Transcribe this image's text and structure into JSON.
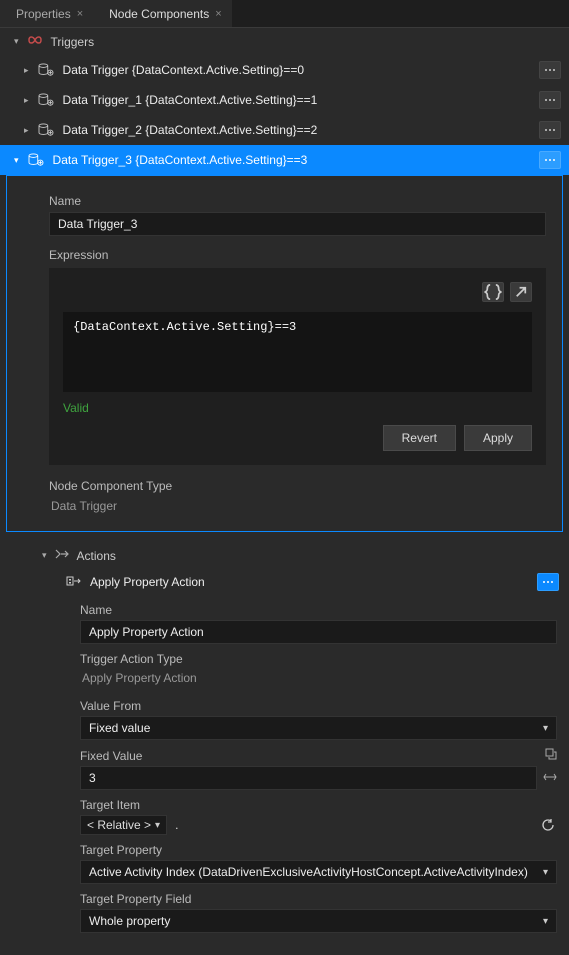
{
  "tabs": {
    "properties": "Properties",
    "nodeComponents": "Node Components"
  },
  "triggersSection": {
    "label": "Triggers"
  },
  "triggers": [
    "Data Trigger {DataContext.Active.Setting}==0",
    "Data Trigger_1 {DataContext.Active.Setting}==1",
    "Data Trigger_2 {DataContext.Active.Setting}==2",
    "Data Trigger_3 {DataContext.Active.Setting}==3"
  ],
  "expanded": {
    "nameLabel": "Name",
    "nameValue": "Data Trigger_3",
    "expressionLabel": "Expression",
    "expressionCode": "{DataContext.Active.Setting}==3",
    "validText": "Valid",
    "revertLabel": "Revert",
    "applyLabel": "Apply",
    "componentTypeLabel": "Node Component Type",
    "componentTypeValue": "Data Trigger"
  },
  "actionsSection": {
    "label": "Actions"
  },
  "action": {
    "title": "Apply Property Action",
    "props": {
      "nameLabel": "Name",
      "nameValue": "Apply Property Action",
      "triggerActionTypeLabel": "Trigger Action Type",
      "triggerActionTypeValue": "Apply Property Action",
      "valueFromLabel": "Value From",
      "valueFromValue": "Fixed value",
      "fixedValueLabel": "Fixed Value",
      "fixedValueValue": "3",
      "targetItemLabel": "Target Item",
      "targetItemChip": "< Relative >",
      "targetItemPath": ".",
      "targetPropertyLabel": "Target Property",
      "targetPropertyValue": "Active Activity Index (DataDrivenExclusiveActivityHostConcept.ActiveActivityIndex)",
      "targetPropertyFieldLabel": "Target Property Field",
      "targetPropertyFieldValue": "Whole property"
    }
  }
}
